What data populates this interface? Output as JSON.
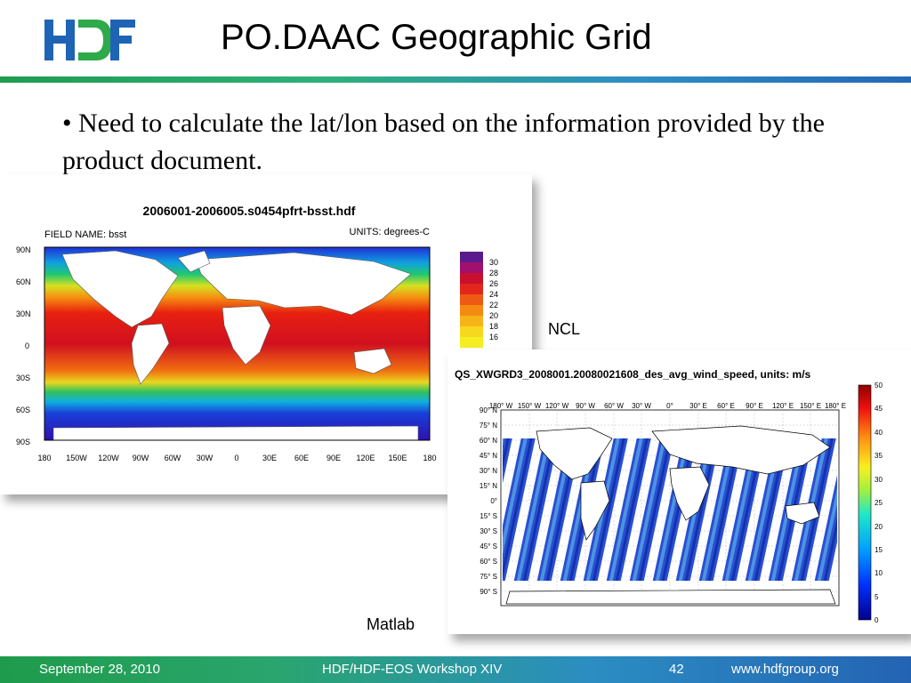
{
  "slide": {
    "title": "PO.DAAC Geographic Grid",
    "bullet_marker": "•",
    "bullet_text": "Need to calculate the lat/lon based on the information provided by the product document."
  },
  "logo": {
    "icon": "hdf-logo",
    "text": "HDF",
    "colors": [
      "#1f64b4",
      "#2eaa4a"
    ]
  },
  "ncl_figure": {
    "label": "NCL",
    "title": "2006001-2006005.s0454pfrt-bsst.hdf",
    "field_name": "FIELD NAME: bsst",
    "units": "UNITS: degrees-C",
    "lat_ticks": [
      "90N",
      "60N",
      "30N",
      "0",
      "30S",
      "60S",
      "90S"
    ],
    "lon_ticks": [
      "180",
      "150W",
      "120W",
      "90W",
      "60W",
      "30W",
      "0",
      "30E",
      "60E",
      "90E",
      "120E",
      "150E",
      "180"
    ],
    "colorbar_ticks": [
      "30",
      "28",
      "26",
      "24",
      "22",
      "20",
      "18",
      "16"
    ],
    "colorbar_colors": [
      "#5a1c8c",
      "#a0106c",
      "#c8102e",
      "#e2261c",
      "#ee5a14",
      "#f58a12",
      "#f7b418",
      "#f7d81e",
      "#f5ee22"
    ]
  },
  "matlab_figure": {
    "label": "Matlab",
    "title": "QS_XWGRD3_2008001.20080021608_des_avg_wind_speed, units: m/s",
    "lon_ticks": [
      "180° W",
      "150° W",
      "120° W",
      "90° W",
      "60° W",
      "30° W",
      "0°",
      "30° E",
      "60° E",
      "90° E",
      "120° E",
      "150° E",
      "180° E"
    ],
    "lat_ticks": [
      "90° N",
      "75° N",
      "60° N",
      "45° N",
      "30° N",
      "15° N",
      "0°",
      "15° S",
      "30° S",
      "45° S",
      "60° S",
      "75° S",
      "90° S"
    ],
    "colorbar_ticks": [
      "50",
      "45",
      "40",
      "35",
      "30",
      "25",
      "20",
      "15",
      "10",
      "5",
      "0"
    ]
  },
  "footer": {
    "date": "September 28, 2010",
    "event": "HDF/HDF-EOS Workshop XIV",
    "page": "42",
    "url": "www.hdfgroup.org"
  }
}
